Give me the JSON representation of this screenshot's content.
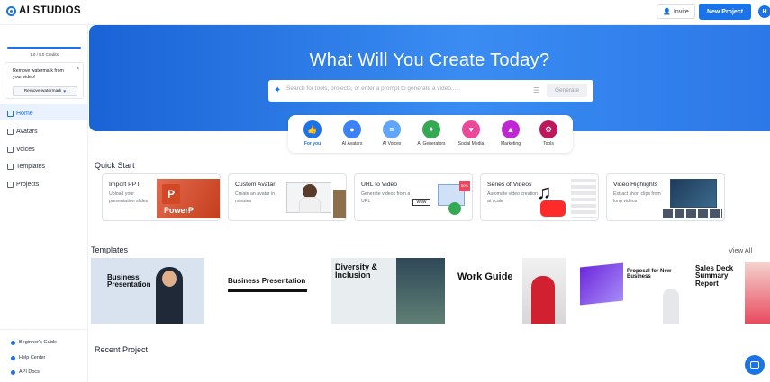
{
  "header": {
    "logo_text": "AI STUDIOS",
    "invite_label": "Invite",
    "new_project_label": "New Project",
    "avatar_initial": "H"
  },
  "sidebar": {
    "credits": "1.0 / 5.0 Credits",
    "credits_fraction": 0.2,
    "watermark_text": "Remove watermark from your video!",
    "watermark_button": "Remove watermark",
    "items": [
      {
        "label": "Home",
        "icon": "home-icon",
        "active": true
      },
      {
        "label": "Avatars",
        "icon": "avatar-icon",
        "active": false
      },
      {
        "label": "Voices",
        "icon": "voice-icon",
        "active": false
      },
      {
        "label": "Templates",
        "icon": "template-icon",
        "active": false
      },
      {
        "label": "Projects",
        "icon": "project-icon",
        "active": false
      }
    ],
    "footer": [
      {
        "label": "Beginner's Guide"
      },
      {
        "label": "Help Center"
      },
      {
        "label": "API Docs"
      }
    ]
  },
  "hero": {
    "title": "What Will You Create Today?",
    "search_placeholder": "Search for tools, projects, or enter a prompt to generate a video......",
    "generate_label": "Generate",
    "categories": [
      {
        "label": "For you",
        "color": "#1a73e8",
        "glyph": "👍"
      },
      {
        "label": "AI Avatars",
        "color": "#3b82f6",
        "glyph": "👤"
      },
      {
        "label": "AI Voices",
        "color": "#60a5fa",
        "glyph": "≡"
      },
      {
        "label": "AI Generators",
        "color": "#34a853",
        "glyph": "✦"
      },
      {
        "label": "Social Media",
        "color": "#ec4899",
        "glyph": "♥"
      },
      {
        "label": "Marketing",
        "color": "#c026d3",
        "glyph": "▲"
      },
      {
        "label": "Tools",
        "color": "#be185d",
        "glyph": "⚙"
      }
    ]
  },
  "quick_start": {
    "title": "Quick Start",
    "cards": [
      {
        "title": "Import PPT",
        "desc": "Upload your presentation slides"
      },
      {
        "title": "Custom Avatar",
        "desc": "Create an avatar in minutes"
      },
      {
        "title": "URL to Video",
        "desc": "Generate videos from a URL"
      },
      {
        "title": "Series of Videos",
        "desc": "Automate video creation at scale"
      },
      {
        "title": "Video Highlights",
        "desc": "Extract short clips from long videos"
      }
    ]
  },
  "templates": {
    "title": "Templates",
    "view_all": "View All",
    "items": [
      {
        "text": "Business Presentation"
      },
      {
        "text": "Business Presentation"
      },
      {
        "text": "Diversity & Inclusion"
      },
      {
        "text": "Work Guide"
      },
      {
        "text": "Proposal for New Business"
      },
      {
        "text": "Sales Deck Summary Report"
      }
    ]
  },
  "recent": {
    "title": "Recent Project"
  }
}
